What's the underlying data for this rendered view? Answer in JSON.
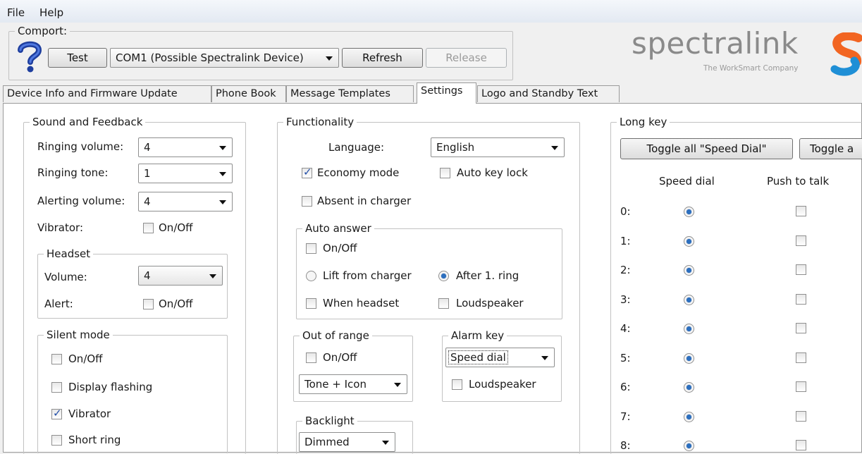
{
  "menu": {
    "file": "File",
    "help": "Help"
  },
  "comport": {
    "legend": "Comport:",
    "test_label": "Test",
    "port_value": "COM1 (Possible Spectralink Device)",
    "refresh_label": "Refresh",
    "release_label": "Release"
  },
  "logo": {
    "name": "spectralink",
    "tagline": "The WorkSmart Company"
  },
  "tabs": [
    {
      "label": "Device Info and Firmware Update"
    },
    {
      "label": "Phone Book"
    },
    {
      "label": "Message Templates"
    },
    {
      "label": "Settings"
    },
    {
      "label": "Logo and Standby Text"
    }
  ],
  "sound": {
    "legend": "Sound and Feedback",
    "ringing_volume_label": "Ringing volume:",
    "ringing_volume_value": "4",
    "ringing_tone_label": "Ringing tone:",
    "ringing_tone_value": "1",
    "alerting_volume_label": "Alerting volume:",
    "alerting_volume_value": "4",
    "vibrator_label": "Vibrator:",
    "vibrator_onoff": "On/Off",
    "headset": {
      "legend": "Headset",
      "volume_label": "Volume:",
      "volume_value": "4",
      "alert_label": "Alert:",
      "alert_onoff": "On/Off"
    },
    "silent": {
      "legend": "Silent mode",
      "onoff": "On/Off",
      "display_flashing": "Display flashing",
      "vibrator": "Vibrator",
      "short_ring": "Short ring"
    }
  },
  "func": {
    "legend": "Functionality",
    "language_label": "Language:",
    "language_value": "English",
    "economy_mode": "Economy mode",
    "auto_key_lock": "Auto key lock",
    "absent_in_charger": "Absent in charger",
    "auto_answer": {
      "legend": "Auto answer",
      "onoff": "On/Off",
      "lift_from_charger": "Lift from charger",
      "after_1_ring": "After 1. ring",
      "when_headset": "When headset",
      "loudspeaker": "Loudspeaker"
    },
    "out_of_range": {
      "legend": "Out of range",
      "onoff": "On/Off",
      "mode_value": "Tone + Icon"
    },
    "alarm_key": {
      "legend": "Alarm key",
      "value": "Speed dial",
      "loudspeaker": "Loudspeaker"
    },
    "backlight": {
      "legend": "Backlight",
      "value": "Dimmed"
    }
  },
  "longkey": {
    "legend": "Long key",
    "toggle_speed_dial": "Toggle all \"Speed Dial\"",
    "toggle_other": "Toggle a",
    "col_speed_dial": "Speed dial",
    "col_push_to_talk": "Push to talk",
    "rows": [
      {
        "key": "0:"
      },
      {
        "key": "1:"
      },
      {
        "key": "2:"
      },
      {
        "key": "3:"
      },
      {
        "key": "4:"
      },
      {
        "key": "5:"
      },
      {
        "key": "6:"
      },
      {
        "key": "7:"
      },
      {
        "key": "8:"
      }
    ]
  },
  "colors": {
    "checkmark": "#2450a8",
    "radio_dot": "#2c6fbf",
    "logo_text": "#8a8a8a",
    "logo_orange": "#f26522",
    "logo_blue": "#1f8fd6"
  }
}
